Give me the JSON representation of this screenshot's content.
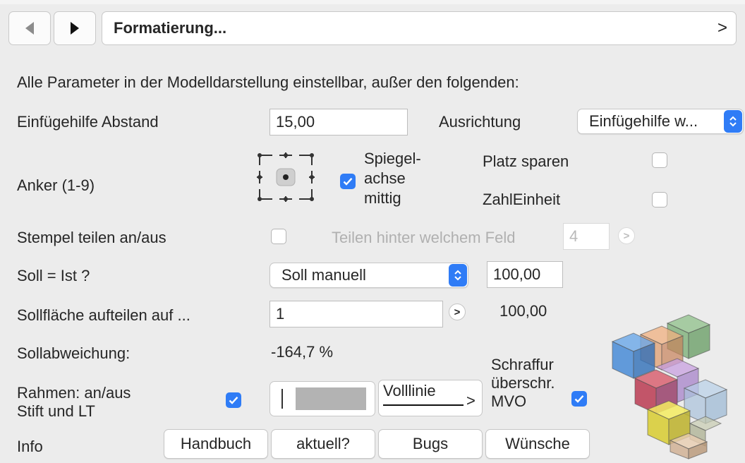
{
  "toolbar": {
    "back_icon": "triangle-left-icon",
    "forward_icon": "triangle-right-icon",
    "section_title": "Formatierung...",
    "section_chevron": ">"
  },
  "intro": "Alle Parameter in der Modelldarstellung einstellbar, außer den folgenden:",
  "insertion_aid": {
    "label": "Einfügehilfe Abstand",
    "value": "15,00",
    "alignment_label": "Ausrichtung",
    "alignment_value": "Einfügehilfe w..."
  },
  "anchor": {
    "label": "Anker (1-9)",
    "selected_point": 5,
    "mirror_label_1": "Spiegel-",
    "mirror_label_2": "achse",
    "mirror_label_3": "mittig",
    "mirror_checked": true,
    "save_space_label": "Platz sparen",
    "save_space_checked": false,
    "number_unit_label": "ZahlEinheit",
    "number_unit_checked": false
  },
  "stamp_split": {
    "label": "Stempel teilen an/aus",
    "checked": false,
    "after_field_label": "Teilen hinter welchem Feld",
    "after_field_value": "4",
    "step_symbol": ">"
  },
  "target": {
    "label": "Soll = Ist ?",
    "mode_value": "Soll manuell",
    "value": "100,00"
  },
  "target_area": {
    "label": "Sollfläche aufteilen auf ...",
    "value": "1",
    "step_symbol": ">",
    "result": "100,00"
  },
  "deviation": {
    "label": "Sollabweichung:",
    "value": "-164,7 %"
  },
  "frame": {
    "label_1": "Rahmen: an/aus",
    "label_2": "Stift und LT",
    "checked": true,
    "line_type": "Volllinie",
    "line_chevron": ">",
    "hatch_label_1": "Schraffur",
    "hatch_label_2": "überschr.",
    "hatch_label_3": "MVO",
    "hatch_checked": true
  },
  "info": {
    "label": "Info",
    "buttons": [
      "Handbuch",
      "aktuell?",
      "Bugs",
      "Wünsche"
    ]
  },
  "colors": {
    "accent": "#2f7cf6",
    "background": "#ececec"
  }
}
